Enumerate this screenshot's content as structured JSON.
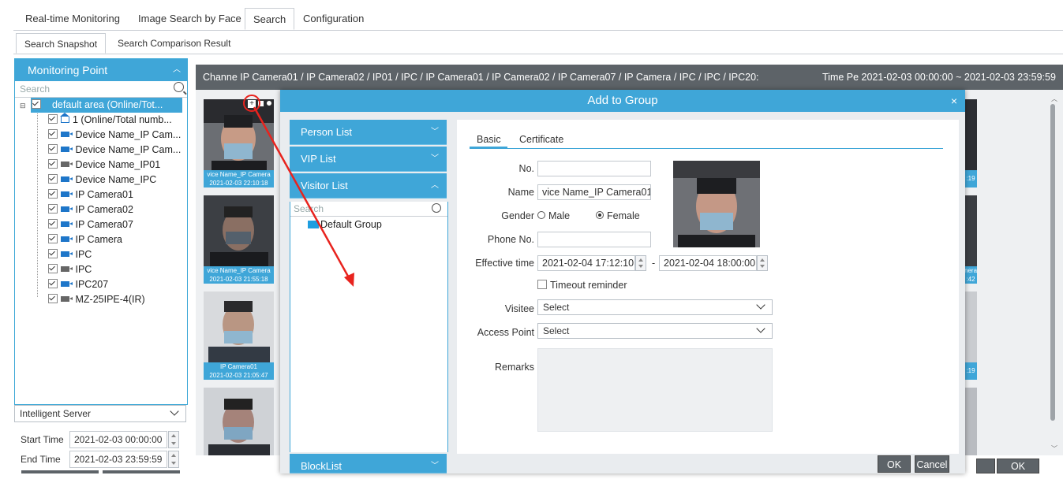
{
  "top_tabs": [
    {
      "label": "Real-time Monitoring"
    },
    {
      "label": "Image Search by Face"
    },
    {
      "label": "Search"
    },
    {
      "label": "Configuration"
    }
  ],
  "sub_tabs": [
    {
      "label": "Search Snapshot"
    },
    {
      "label": "Search Comparison Result"
    }
  ],
  "left_panel": {
    "title": "Monitoring Point",
    "search_placeholder": "Search",
    "tree": [
      {
        "label": "default area (Online/Tot..."
      },
      {
        "label": "1 (Online/Total numb..."
      },
      {
        "label": "Device Name_IP Cam..."
      },
      {
        "label": "Device Name_IP Cam..."
      },
      {
        "label": "Device Name_IP01"
      },
      {
        "label": "Device Name_IPC"
      },
      {
        "label": "IP Camera01"
      },
      {
        "label": "IP Camera02"
      },
      {
        "label": "IP Camera07"
      },
      {
        "label": "IP Camera"
      },
      {
        "label": "IPC"
      },
      {
        "label": "IPC"
      },
      {
        "label": "IPC207"
      },
      {
        "label": "MZ-25IPE-4(IR)"
      }
    ],
    "server_select": "Intelligent Server",
    "start_time_label": "Start Time",
    "start_time": "2021-02-03 00:00:00",
    "end_time_label": "End Time",
    "end_time": "2021-02-03 23:59:59"
  },
  "channel_bar": {
    "channel_text": "Channe IP Camera01 / IP Camera02 / IP01 / IPC / IP Camera01 / IP Camera02 / IP Camera07 / IP Camera / IPC / IPC / IPC20:",
    "time_text": "Time Pe 2021-02-03 00:00:00 ~ 2021-02-03 23:59:59"
  },
  "thumbnails": [
    {
      "name": "vice Name_IP Camera",
      "time": "2021-02-03 22:10:18"
    },
    {
      "name": "vice Name_IP Camera",
      "time": "2021-02-03 21:55:18"
    },
    {
      "name": "IP Camera01",
      "time": "2021-02-03 21:05:47"
    }
  ],
  "right_caps": [
    ":19",
    "nera",
    ":42",
    ":19"
  ],
  "dialog": {
    "title": "Add to Group",
    "close": "×",
    "lists": {
      "person": "Person List",
      "vip": "VIP List",
      "visitor": "Visitor List",
      "block": "BlockList"
    },
    "visitor_search_placeholder": "Search",
    "default_group": "Default Group",
    "form_tabs": {
      "basic": "Basic",
      "certificate": "Certificate"
    },
    "fields": {
      "no_label": "No.",
      "no_value": "",
      "name_label": "Name",
      "name_value": "vice Name_IP Camera01",
      "gender_label": "Gender",
      "male": "Male",
      "female": "Female",
      "gender_selected": "Female",
      "phone_label": "Phone No.",
      "phone_value": "",
      "effective_label": "Effective time",
      "effective_start": "2021-02-04 17:12:10",
      "effective_sep": "-",
      "effective_end": "2021-02-04 18:00:00",
      "timeout_label": "Timeout reminder",
      "visitee_label": "Visitee",
      "visitee_value": "Select",
      "access_label": "Access Point",
      "access_value": "Select",
      "remarks_label": "Remarks"
    },
    "ok": "OK",
    "cancel": "Cancel"
  },
  "bottom_ok": "OK",
  "colors": {
    "accent": "#3fa6d8",
    "dark_bar": "#5d6368",
    "annotation": "#e8231e"
  }
}
